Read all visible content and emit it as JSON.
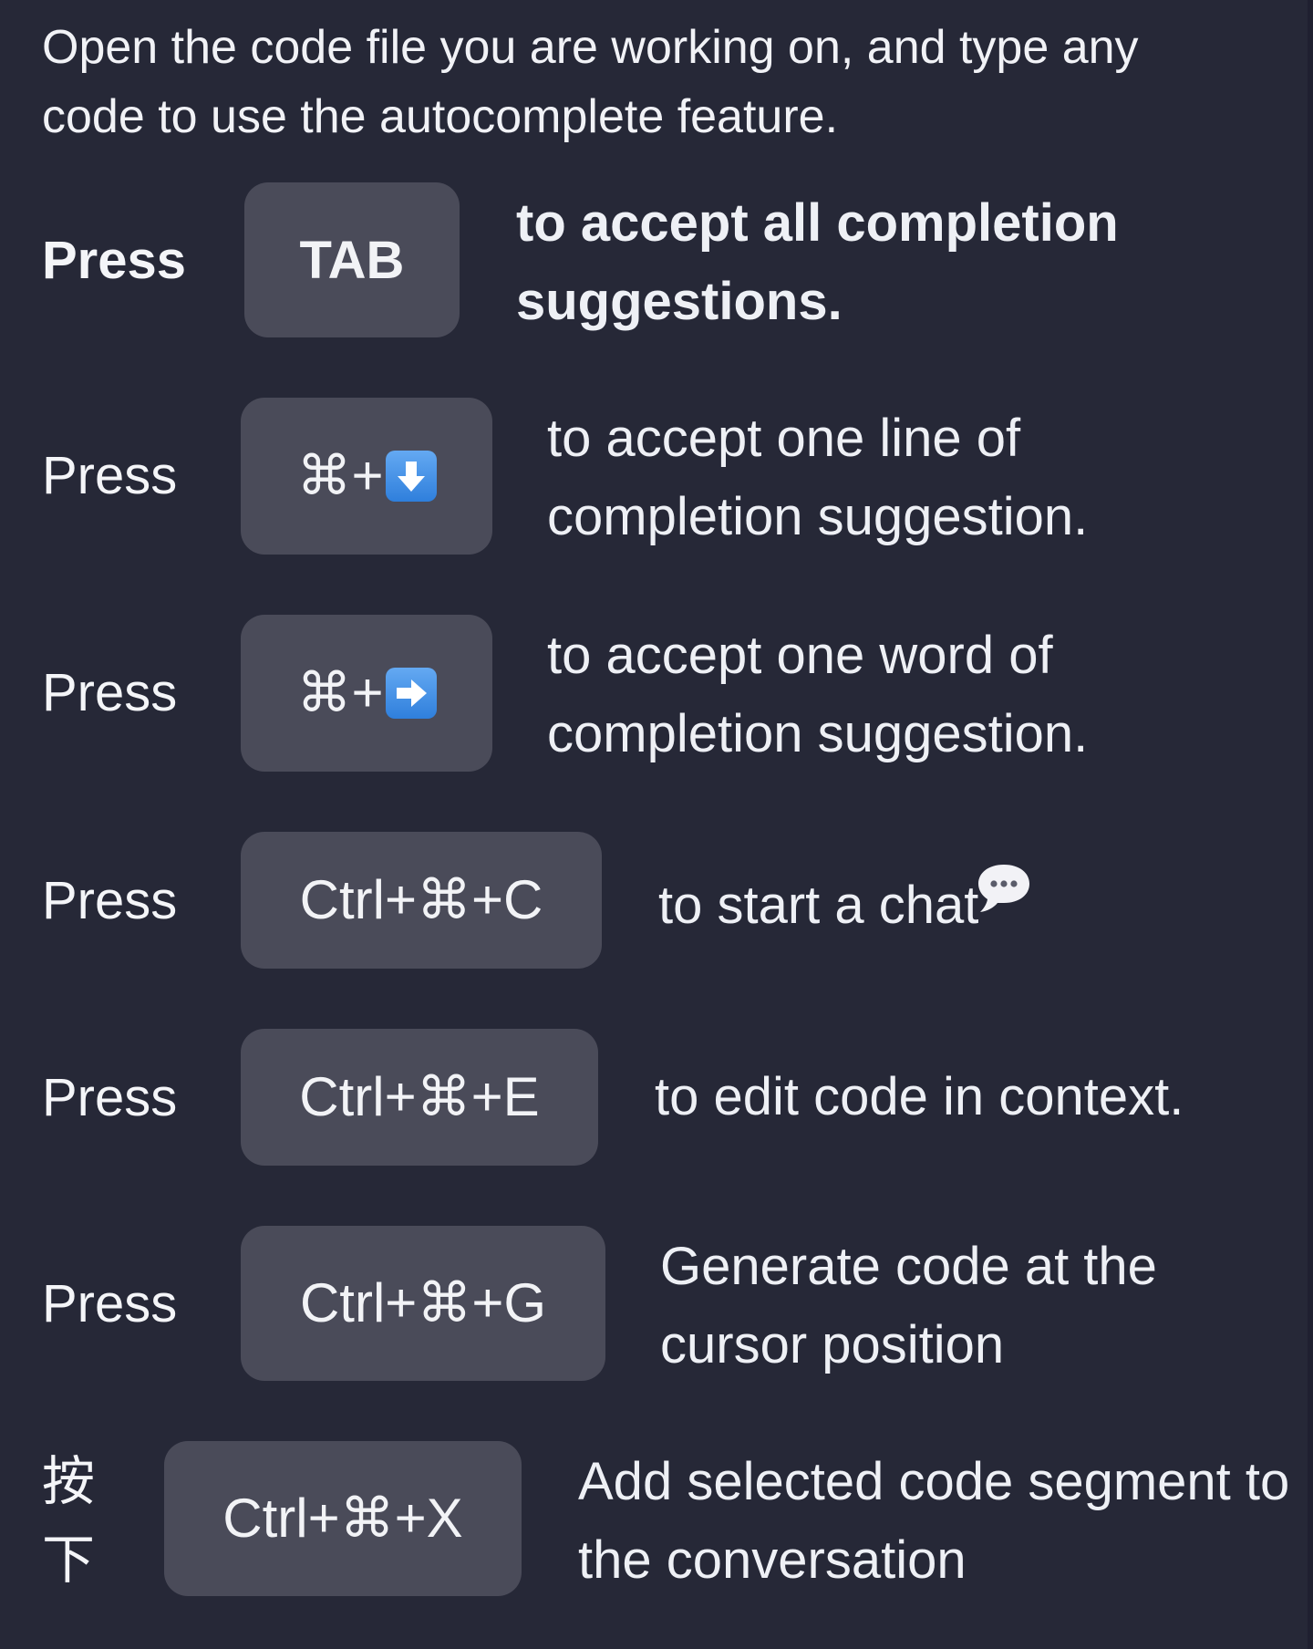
{
  "intro": {
    "text": "Open the code file you are working on, and type any code to use the autocomplete feature."
  },
  "shortcuts": [
    {
      "press": "Press",
      "key": "TAB",
      "desc": "to accept all completion suggestions.",
      "bold": true
    },
    {
      "press": "Press",
      "key_prefix": "⌘+",
      "key_icon": "down-arrow-icon",
      "desc": "to accept one line of completion suggestion."
    },
    {
      "press": "Press",
      "key_prefix": "⌘+",
      "key_icon": "right-arrow-icon",
      "desc": "to accept one word of completion suggestion."
    },
    {
      "press": "Press",
      "key": "Ctrl+⌘+C",
      "desc": "to start a chat",
      "desc_icon": "speech-bubble-icon"
    },
    {
      "press": "Press",
      "key": "Ctrl+⌘+E",
      "desc": "to edit code in context."
    },
    {
      "press": "Press",
      "key": "Ctrl+⌘+G",
      "desc": "Generate code at the cursor position"
    },
    {
      "press": "按下",
      "key": "Ctrl+⌘+X",
      "desc": "Add selected code segment to the conversation"
    }
  ],
  "colors": {
    "background": "#262837",
    "key_background": "#4a4b59",
    "text": "#eef0f5",
    "arrow_icon": "#3b8ae6"
  }
}
